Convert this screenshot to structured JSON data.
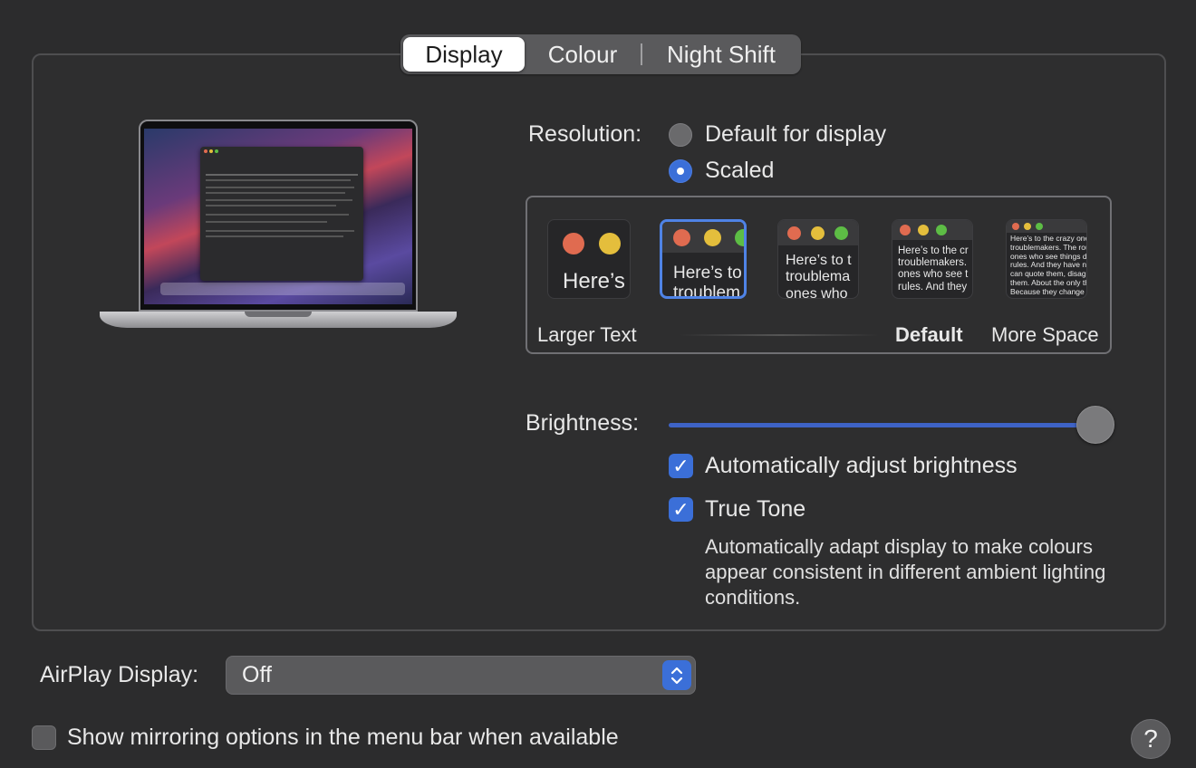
{
  "tabs": [
    {
      "label": "Display",
      "active": true
    },
    {
      "label": "Colour",
      "active": false
    },
    {
      "label": "Night Shift",
      "active": false
    }
  ],
  "resolution": {
    "label": "Resolution:",
    "options": [
      {
        "label": "Default for display",
        "selected": false
      },
      {
        "label": "Scaled",
        "selected": true
      }
    ],
    "scaled_thumbnails": [
      {
        "text": "Here’s",
        "selected": false
      },
      {
        "text": "Here’s to\ntroublem",
        "selected": true
      },
      {
        "text": "Here’s to t\ntroublema\nones who",
        "selected": false
      },
      {
        "text": "Here’s to the cr\ntroublemakers.\nones who see t\nrules. And they",
        "selected": false
      },
      {
        "text": "Here’s to the crazy one\ntroublemakers. The rou\nones who see things dif\nrules. And they have no\ncan quote them, disagre\nthem. About the only th\nBecause they change th",
        "selected": false
      }
    ],
    "scale_labels": {
      "left": "Larger Text",
      "default": "Default",
      "right": "More Space"
    }
  },
  "brightness": {
    "label": "Brightness:",
    "value": 0.97
  },
  "auto_brightness": {
    "label": "Automatically adjust brightness",
    "checked": true
  },
  "true_tone": {
    "label": "True Tone",
    "checked": true,
    "description": "Automatically adapt display to make colours appear consistent in different ambient lighting conditions."
  },
  "airplay": {
    "label": "AirPlay Display:",
    "value": "Off"
  },
  "mirroring": {
    "label": "Show mirroring options in the menu bar when available",
    "checked": false
  },
  "help": {
    "label": "?"
  },
  "colors": {
    "accent": "#3b6fd8",
    "background": "#2c2c2d"
  },
  "icons": [
    "macbook-pro-illustration",
    "chevron-up-down-icon",
    "checkmark-icon",
    "help-icon"
  ]
}
